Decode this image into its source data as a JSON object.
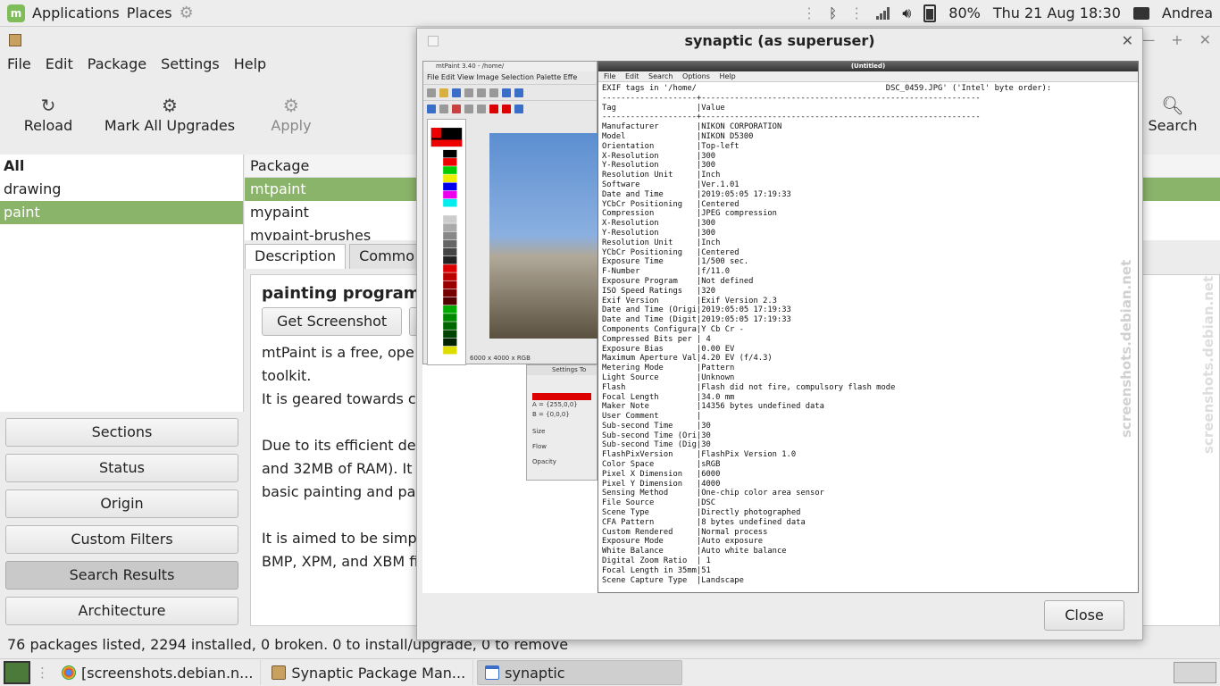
{
  "top_panel": {
    "applications": "Applications",
    "places": "Places",
    "battery": "80%",
    "clock": "Thu 21 Aug  18:30",
    "user": "Andrea"
  },
  "synaptic": {
    "menus": [
      "File",
      "Edit",
      "Package",
      "Settings",
      "Help"
    ],
    "toolbar": {
      "reload": "Reload",
      "mark_all": "Mark All Upgrades",
      "apply": "Apply",
      "search": "Search"
    },
    "filters": [
      "All",
      "drawing",
      "paint"
    ],
    "side_buttons": [
      "Sections",
      "Status",
      "Origin",
      "Custom Filters",
      "Search Results",
      "Architecture"
    ],
    "package_header": "Package",
    "packages": [
      "mtpaint",
      "mypaint",
      "mypaint-brushes"
    ],
    "tabs": [
      "Description",
      "Commo"
    ],
    "detail": {
      "title": "painting program",
      "get_screenshot": "Get Screenshot",
      "para1": "mtPaint is a free, ope",
      "para1b": "toolkit.",
      "para2": "It is geared towards c",
      "para3": "Due to its efficient de",
      "para3b": "and 32MB of RAM). It",
      "para3c": "basic painting and pa",
      "para4": "It is aimed to be simp",
      "para4b": "BMP, XPM, and XBM fi"
    },
    "status": "76 packages listed, 2294 installed, 0 broken. 0 to install/upgrade, 0 to remove"
  },
  "dialog": {
    "title": "synaptic (as superuser)",
    "close_label": "Close",
    "mtpaint": {
      "title": "mtPaint 3.40 - /home/",
      "menu": "File  Edit  View  Image  Selection  Palette  Effe",
      "size": "6000 x 4000 x RGB",
      "settings_title": "Settings To",
      "settings_a": "A = {255,0,0}",
      "settings_b": "B = {0,0,0}",
      "size_label": "Size",
      "flow_label": "Flow",
      "opacity_label": "Opacity"
    },
    "exif": {
      "title": "(Untitled)",
      "menus": [
        "File",
        "Edit",
        "Search",
        "Options",
        "Help"
      ],
      "text": "EXIF tags in '/home/                                        DSC_0459.JPG' ('Intel' byte order):\n--------------------+-----------------------------------------------------------\nTag                 |Value\n--------------------+-----------------------------------------------------------\nManufacturer        |NIKON CORPORATION\nModel               |NIKON D5300\nOrientation         |Top-left\nX-Resolution        |300\nY-Resolution        |300\nResolution Unit     |Inch\nSoftware            |Ver.1.01\nDate and Time       |2019:05:05 17:19:33\nYCbCr Positioning   |Centered\nCompression         |JPEG compression\nX-Resolution        |300\nY-Resolution        |300\nResolution Unit     |Inch\nYCbCr Positioning   |Centered\nExposure Time       |1/500 sec.\nF-Number            |f/11.0\nExposure Program    |Not defined\nISO Speed Ratings   |320\nExif Version        |Exif Version 2.3\nDate and Time (Origi|2019:05:05 17:19:33\nDate and Time (Digit|2019:05:05 17:19:33\nComponents Configura|Y Cb Cr -\nCompressed Bits per | 4\nExposure Bias       |0.00 EV\nMaximum Aperture Val|4.20 EV (f/4.3)\nMetering Mode       |Pattern\nLight Source        |Unknown\nFlash               |Flash did not fire, compulsory flash mode\nFocal Length        |34.0 mm\nMaker Note          |14356 bytes undefined data\nUser Comment        |\nSub-second Time     |30\nSub-second Time (Ori|30\nSub-second Time (Dig|30\nFlashPixVersion     |FlashPix Version 1.0\nColor Space         |sRGB\nPixel X Dimension   |6000\nPixel Y Dimension   |4000\nSensing Method      |One-chip color area sensor\nFile Source         |DSC\nScene Type          |Directly photographed\nCFA Pattern         |8 bytes undefined data\nCustom Rendered     |Normal process\nExposure Mode       |Auto exposure\nWhite Balance       |Auto white balance\nDigital Zoom Ratio  | 1\nFocal Length in 35mm|51\nScene Capture Type  |Landscape"
    }
  },
  "watermark": "screenshots.debian.net",
  "taskbar": {
    "items": [
      "[screenshots.debian.n...",
      "Synaptic Package Man...",
      "synaptic"
    ]
  },
  "colors": {
    "selection_green": "#8ab46a",
    "battery_indicator": "#333333"
  }
}
